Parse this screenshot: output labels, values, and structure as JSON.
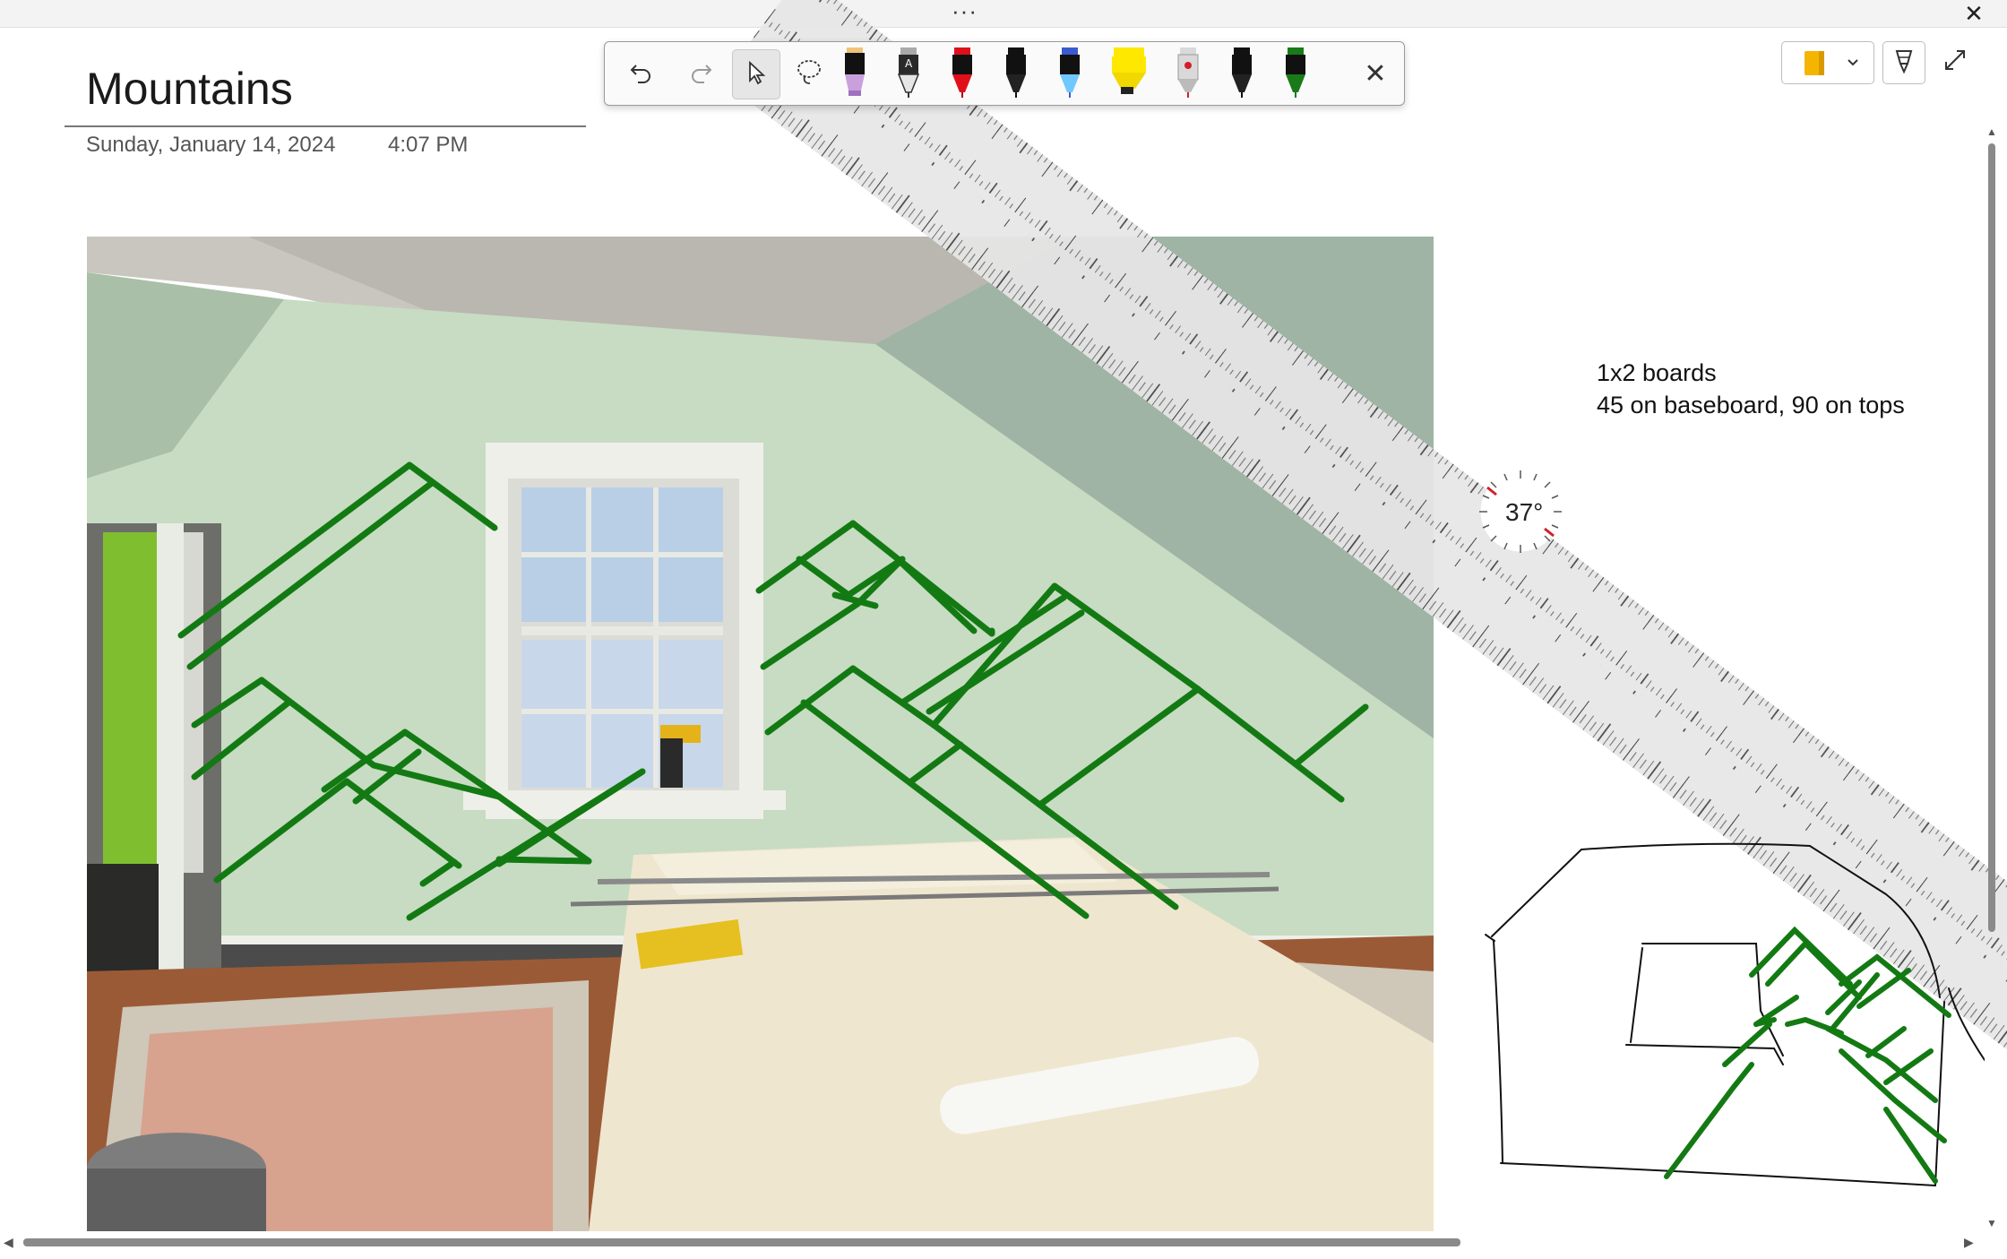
{
  "window": {
    "more_icon": "ellipsis-icon",
    "close_icon": "close-icon"
  },
  "page": {
    "title": "Mountains",
    "date": "Sunday, January 14, 2024",
    "time": "4:07 PM"
  },
  "note_text": {
    "line1": "1x2 boards",
    "line2": "45 on baseboard, 90 on tops"
  },
  "ruler": {
    "angle_label": "37°"
  },
  "toolbar": {
    "undo_icon": "undo-icon",
    "redo_icon": "redo-icon",
    "select_icon": "cursor-icon",
    "lasso_icon": "lasso-icon",
    "pens": [
      {
        "name": "black-pen-purple",
        "color": "#000000",
        "accent": "#c9a0dc"
      },
      {
        "name": "pencil-gray",
        "color": "#b0b0b0",
        "accent": "#444444"
      },
      {
        "name": "red-pen",
        "color": "#e0101a",
        "accent": "#e0101a"
      },
      {
        "name": "black-pen",
        "color": "#111111",
        "accent": "#111111"
      },
      {
        "name": "galaxy-pen",
        "color": "#3a5bd0",
        "accent": "#6fc8ff"
      },
      {
        "name": "yellow-highlighter",
        "color": "#ffe800",
        "accent": "#ffe800"
      },
      {
        "name": "red-ruby-pen",
        "color": "#d9d9d9",
        "accent": "#d0202a"
      },
      {
        "name": "black-pen-2",
        "color": "#111111",
        "accent": "#111111"
      },
      {
        "name": "green-pen",
        "color": "#1a7a1a",
        "accent": "#1a7a1a"
      }
    ],
    "close_icon": "close-icon"
  },
  "right_controls": {
    "notebook_icon": "notebook-icon",
    "dropdown_icon": "chevron-down-icon",
    "pen_mode_icon": "pen-icon",
    "expand_icon": "expand-icon"
  },
  "colors": {
    "ink_green": "#137a13",
    "wall": "#c9dfc3",
    "ruler_fill": "#e6e6e6"
  }
}
